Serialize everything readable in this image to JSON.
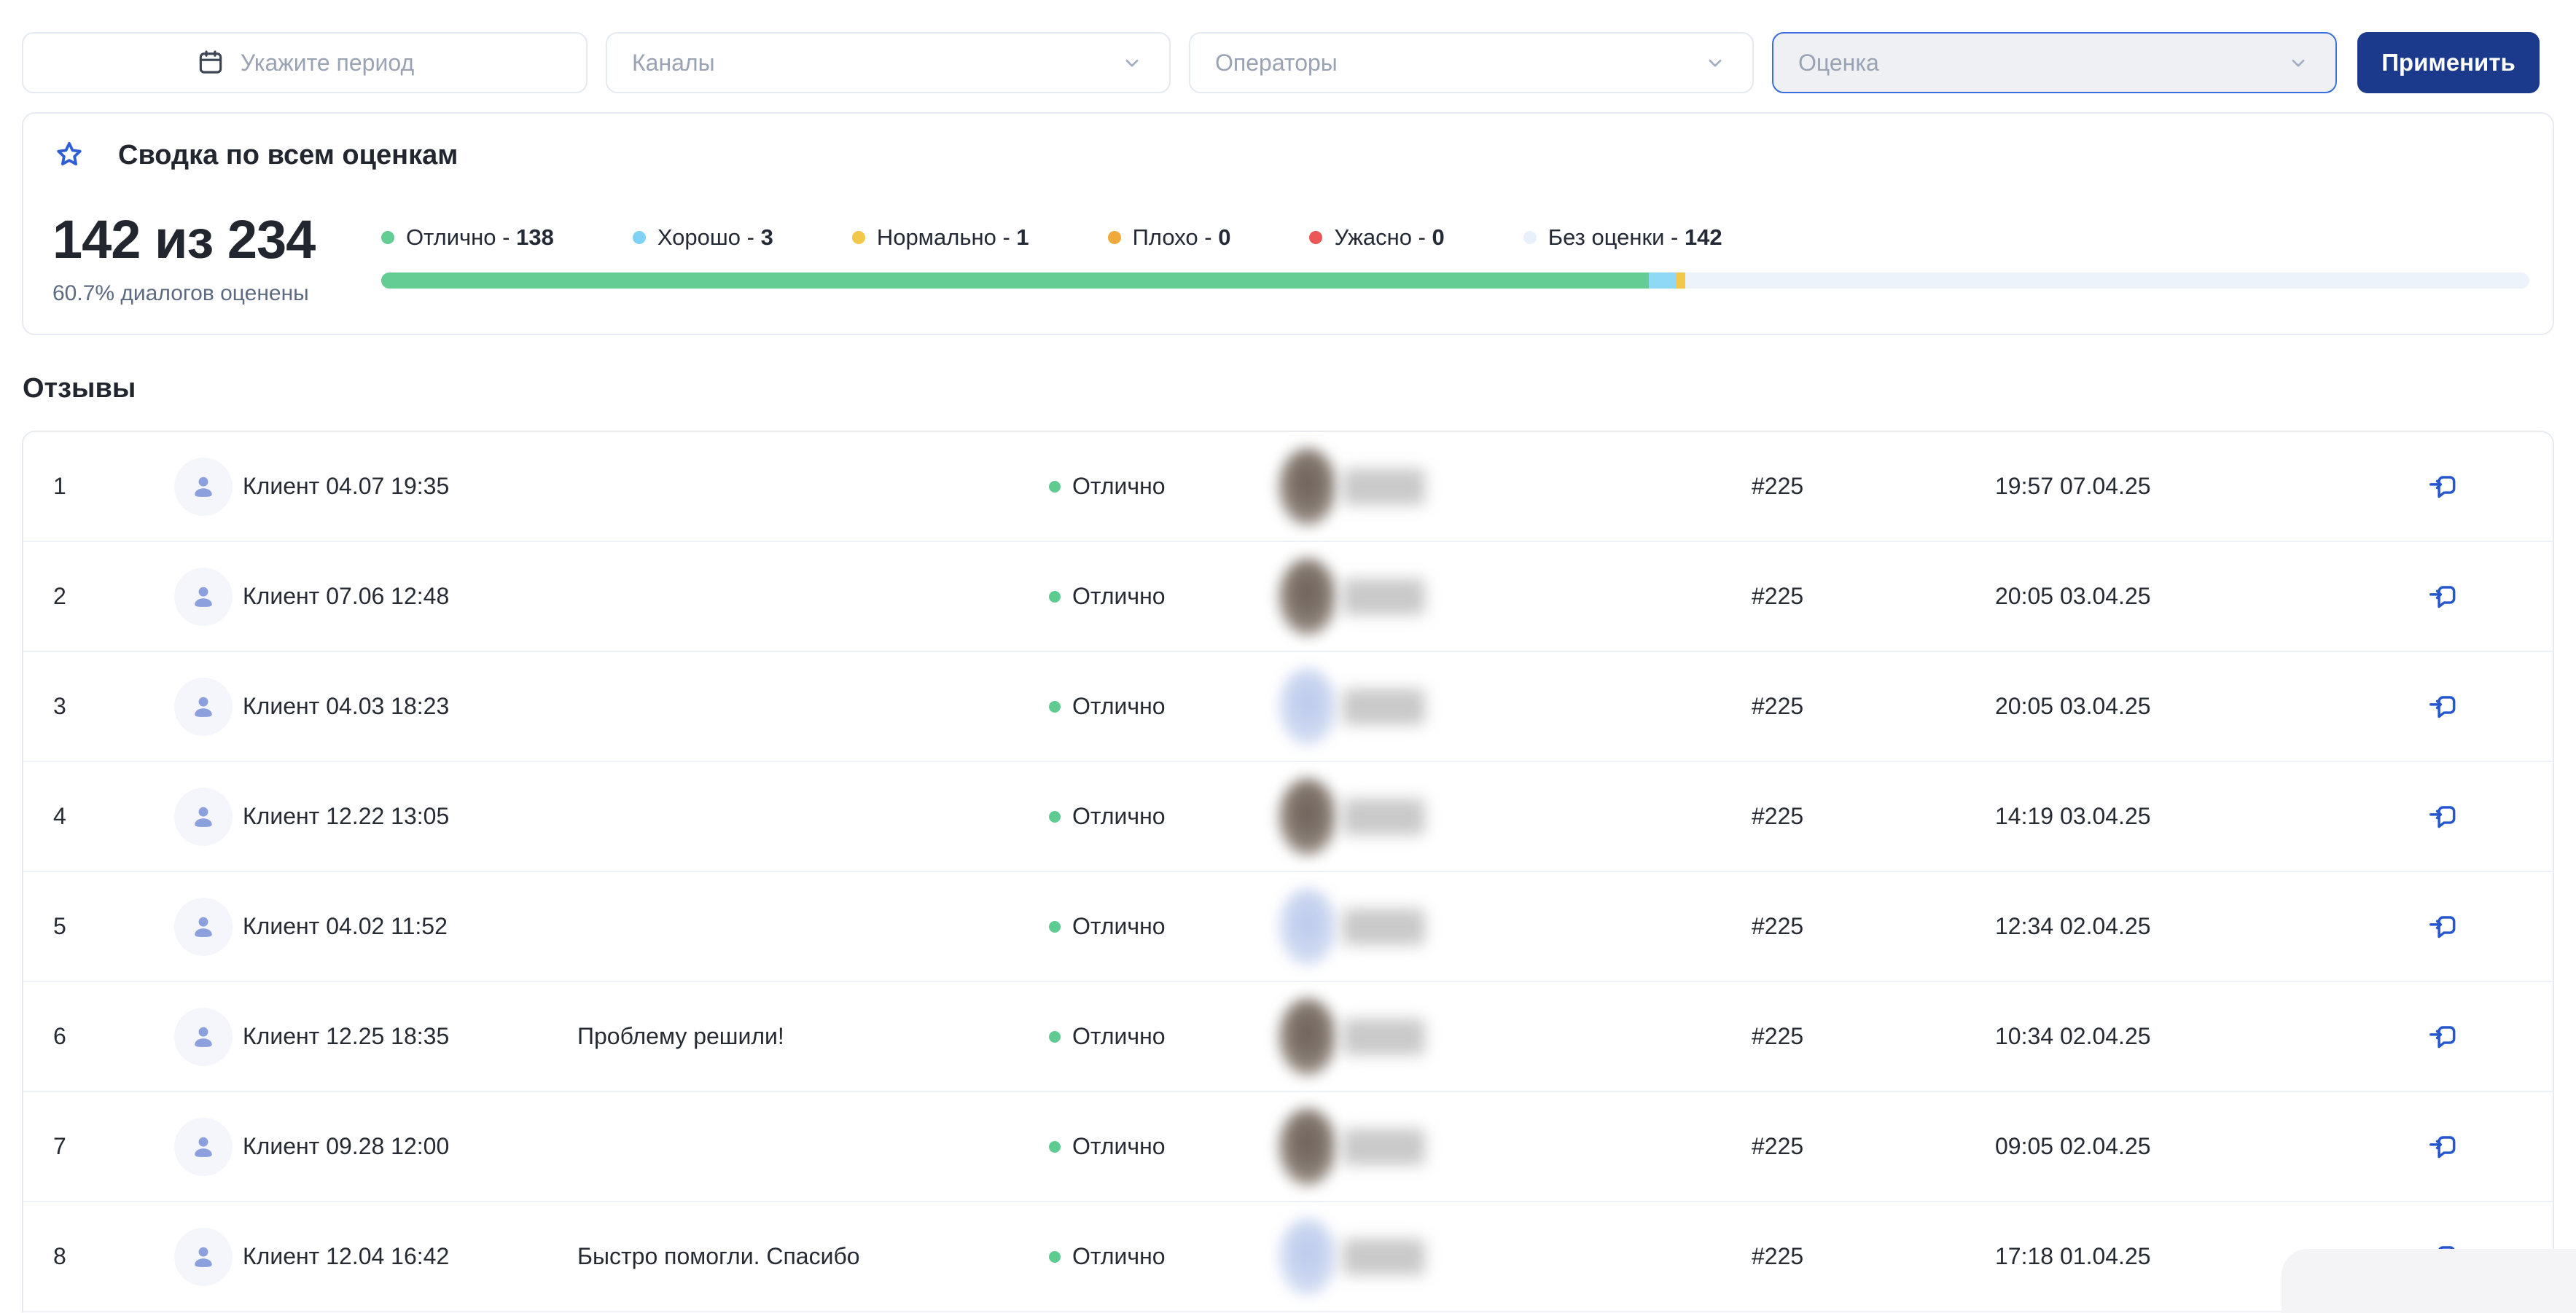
{
  "filters": {
    "period_placeholder": "Укажите период",
    "channels_placeholder": "Каналы",
    "operators_placeholder": "Операторы",
    "rating_placeholder": "Оценка",
    "apply_label": "Применить"
  },
  "summary": {
    "title": "Сводка по всем оценкам",
    "score": "142 из 234",
    "caption": "60.7% диалогов оценены",
    "legend": [
      {
        "label": "Отлично",
        "value": "138",
        "color": "#63cd93"
      },
      {
        "label": "Хорошо",
        "value": "3",
        "color": "#7fd2f5"
      },
      {
        "label": "Нормально",
        "value": "1",
        "color": "#f2c84b"
      },
      {
        "label": "Плохо",
        "value": "0",
        "color": "#f0a93b"
      },
      {
        "label": "Ужасно",
        "value": "0",
        "color": "#eb5757"
      },
      {
        "label": "Без оценки",
        "value": "142",
        "color": "#e8f1fb"
      }
    ],
    "bar_segments": [
      {
        "color": "#63cd93",
        "pct": 59.0
      },
      {
        "color": "#8fd9f6",
        "pct": 1.28
      },
      {
        "color": "#f2c84b",
        "pct": 0.43
      },
      {
        "color": "#edf3fa",
        "pct": 39.29
      }
    ]
  },
  "reviews": {
    "heading": "Отзывы",
    "rows": [
      {
        "num": "1",
        "client": "Клиент 04.07 19:35",
        "comment": "",
        "rating": "Отлично",
        "ticket": "#225",
        "time": "19:57 07.04.25",
        "avatar": "brown"
      },
      {
        "num": "2",
        "client": "Клиент 07.06 12:48",
        "comment": "",
        "rating": "Отлично",
        "ticket": "#225",
        "time": "20:05 03.04.25",
        "avatar": "brown"
      },
      {
        "num": "3",
        "client": "Клиент 04.03 18:23",
        "comment": "",
        "rating": "Отлично",
        "ticket": "#225",
        "time": "20:05 03.04.25",
        "avatar": "blue"
      },
      {
        "num": "4",
        "client": "Клиент 12.22 13:05",
        "comment": "",
        "rating": "Отлично",
        "ticket": "#225",
        "time": "14:19 03.04.25",
        "avatar": "brown"
      },
      {
        "num": "5",
        "client": "Клиент 04.02 11:52",
        "comment": "",
        "rating": "Отлично",
        "ticket": "#225",
        "time": "12:34 02.04.25",
        "avatar": "blue"
      },
      {
        "num": "6",
        "client": "Клиент 12.25 18:35",
        "comment": "Проблему решили!",
        "rating": "Отлично",
        "ticket": "#225",
        "time": "10:34 02.04.25",
        "avatar": "brown"
      },
      {
        "num": "7",
        "client": "Клиент 09.28 12:00",
        "comment": "",
        "rating": "Отлично",
        "ticket": "#225",
        "time": "09:05 02.04.25",
        "avatar": "brown"
      },
      {
        "num": "8",
        "client": "Клиент 12.04 16:42",
        "comment": "Быстро помогли. Спасибо",
        "rating": "Отлично",
        "ticket": "#225",
        "time": "17:18 01.04.25",
        "avatar": "blue"
      }
    ]
  },
  "colors": {
    "accent_blue": "#2456d0",
    "apply_navy": "#1c3a8c",
    "rating_green": "#5ecb90"
  }
}
